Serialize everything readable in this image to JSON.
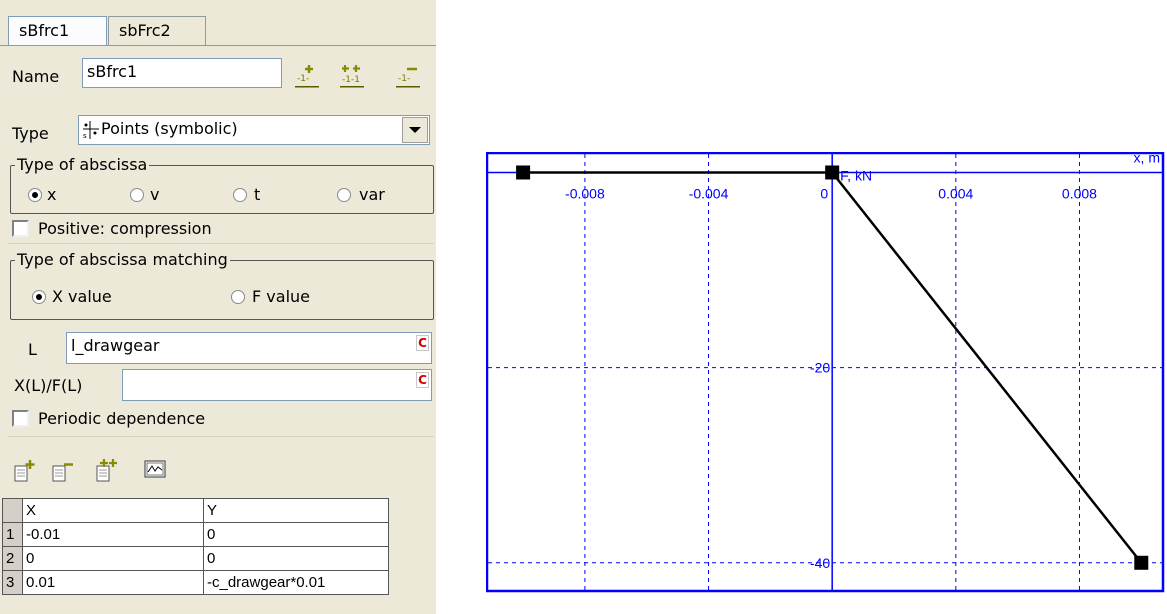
{
  "tabs": [
    "sBfrc1",
    "sbFrc2"
  ],
  "name_label": "Name",
  "name_value": "sBfrc1",
  "type_label": "Type",
  "type_value": "Points (symbolic)",
  "abscissa_group": {
    "title": "Type of abscissa",
    "options": [
      "x",
      "v",
      "t",
      "var"
    ],
    "selected": "x"
  },
  "positive_compression_label": "Positive: compression",
  "matching_group": {
    "title": "Type of abscissa matching",
    "options": [
      "X value",
      "F value"
    ],
    "selected": "X value"
  },
  "L_label": "L",
  "L_value": "l_drawgear",
  "XF_label": "X(L)/F(L)",
  "XF_value": "",
  "c_button": "C",
  "periodic_label": "Periodic dependence",
  "table": {
    "headers": [
      "X",
      "Y"
    ],
    "rows": [
      {
        "n": "1",
        "x": "-0.01",
        "y": "0"
      },
      {
        "n": "2",
        "x": "0",
        "y": "0"
      },
      {
        "n": "3",
        "x": "0.01",
        "y": "-c_drawgear*0.01"
      }
    ]
  },
  "chart_data": {
    "type": "line",
    "xlabel": "x, m",
    "ylabel": "F, kN",
    "x_ticks": [
      "-0.008",
      "-0.004",
      "0",
      "0.004",
      "0.008"
    ],
    "y_ticks": [
      "-20",
      "-40"
    ],
    "xlim": [
      -0.0112,
      0.0108
    ],
    "ylim": [
      -43.2,
      2.1
    ],
    "grid": true,
    "series": [
      {
        "x": [
          -0.01,
          0,
          0.01
        ],
        "y": [
          0,
          0,
          -40
        ]
      }
    ],
    "colors": {
      "axis": "#0000ff",
      "line": "#000000",
      "grid": "#0000ff"
    }
  }
}
